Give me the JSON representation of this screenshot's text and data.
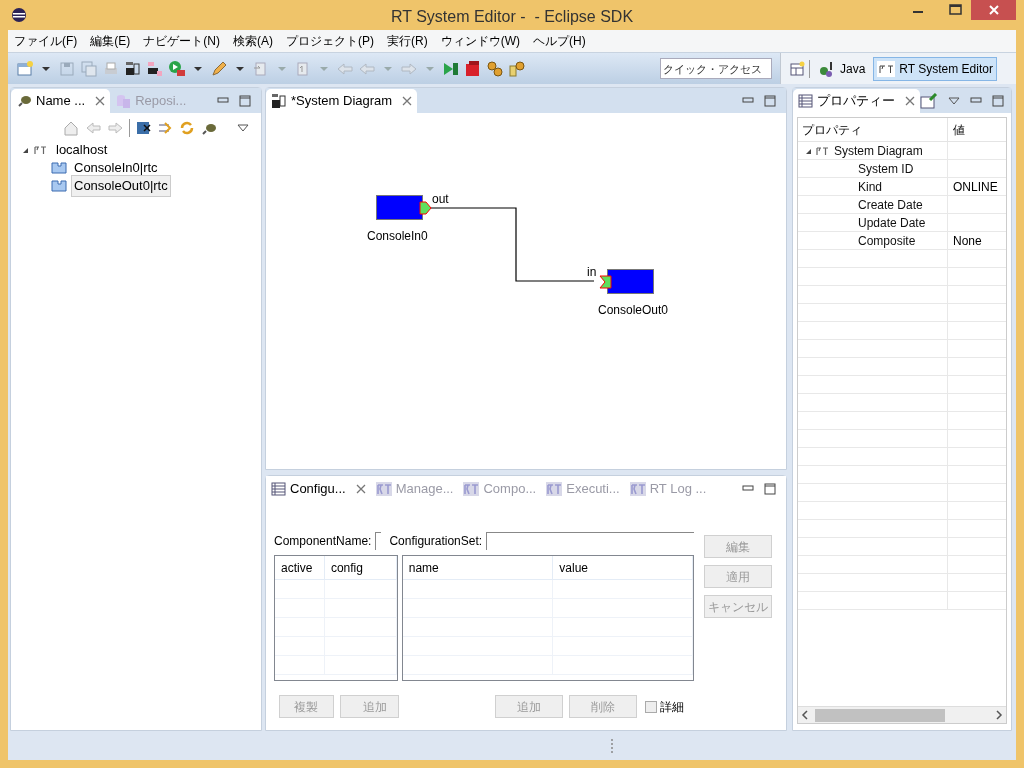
{
  "window": {
    "title": "RT System Editor -  - Eclipse SDK"
  },
  "menu": [
    "ファイル(F)",
    "編集(E)",
    "ナビゲート(N)",
    "検索(A)",
    "プロジェクト(P)",
    "実行(R)",
    "ウィンドウ(W)",
    "ヘルプ(H)"
  ],
  "toolbar": {
    "quick_access": {
      "placeholder": "クイック・アクセス"
    }
  },
  "perspectives": [
    {
      "label": "Java",
      "selected": false
    },
    {
      "label": "RT System Editor",
      "selected": true
    }
  ],
  "left_panel": {
    "tabs": [
      {
        "label": "Name ...",
        "selected": true
      },
      {
        "label": "Reposi...",
        "selected": false
      }
    ],
    "tree": [
      {
        "label": "localhost",
        "expanded": true,
        "selected": false,
        "children": [
          {
            "label": "ConsoleIn0|rtc",
            "selected": false
          },
          {
            "label": "ConsoleOut0|rtc",
            "selected": true
          }
        ]
      }
    ]
  },
  "editor": {
    "tab": {
      "label": "*System Diagram",
      "selected": true
    },
    "components": [
      {
        "name": "ConsoleIn0",
        "port": {
          "kind": "out",
          "label": "out"
        }
      },
      {
        "name": "ConsoleOut0",
        "port": {
          "kind": "in",
          "label": "in"
        }
      }
    ]
  },
  "properties": {
    "tab": {
      "label": "プロパティー",
      "selected": true
    },
    "columns": [
      "プロパティ",
      "値"
    ],
    "rows": [
      {
        "label": "System Diagram",
        "expanded": true,
        "children": [
          {
            "label": "System ID"
          },
          {
            "label": "Kind",
            "value": "ONLINE"
          },
          {
            "label": "Create Date"
          },
          {
            "label": "Update Date"
          },
          {
            "label": "Composite",
            "value": "None"
          }
        ]
      }
    ]
  },
  "bottom_panel": {
    "tabs": [
      {
        "label": "Configu...",
        "selected": true
      },
      {
        "label": "Manage...",
        "selected": false
      },
      {
        "label": "Compo...",
        "selected": false
      },
      {
        "label": "Executi...",
        "selected": false
      },
      {
        "label": "RT Log ...",
        "selected": false
      }
    ],
    "component_name_label": "ComponentName:",
    "configuration_set_label": "ConfigurationSet:",
    "left_table": {
      "columns": [
        "active",
        "config"
      ]
    },
    "right_table": {
      "columns": [
        "name",
        "value"
      ]
    },
    "side_buttons": [
      {
        "label": "編集",
        "disabled": true
      },
      {
        "label": "適用",
        "disabled": true
      },
      {
        "label": "キャンセル",
        "disabled": true
      }
    ],
    "left_buttons": [
      {
        "label": "複製",
        "disabled": true
      },
      {
        "label": "追加",
        "disabled": true
      }
    ],
    "right_buttons": [
      {
        "label": "追加",
        "disabled": true
      },
      {
        "label": "削除",
        "disabled": true
      }
    ],
    "detail_checkbox": {
      "label": "詳細",
      "checked": false
    }
  }
}
